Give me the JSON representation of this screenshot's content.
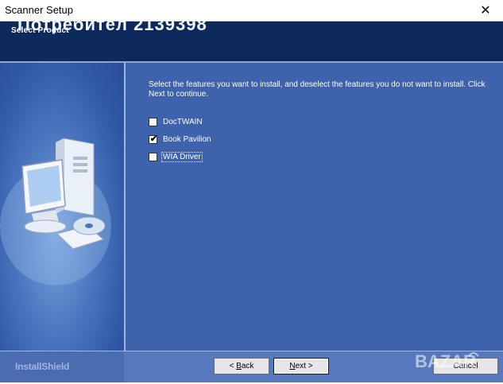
{
  "window": {
    "title": "Scanner Setup",
    "close_label": "✕"
  },
  "header": {
    "subtitle": "Select Product",
    "watermark": "Потребител 2139398"
  },
  "main": {
    "instructions": "Select the features you want to install, and deselect the features you do not want to install.  Click Next to continue.",
    "features": [
      {
        "label": "DocTWAIN",
        "checked": false
      },
      {
        "label": "Book Pavilion",
        "checked": true
      },
      {
        "label": "WIA Driver",
        "checked": false
      }
    ]
  },
  "footer": {
    "brand": "InstallShield",
    "back_label": "Back",
    "back_prefix": "< ",
    "back_accel": "B",
    "next_label": "Next >",
    "next_accel": "N",
    "cancel_label": "Cancel"
  },
  "logo": {
    "text": "BAZAR",
    "icon": "bazar-logo"
  },
  "colors": {
    "header": "#0e2a5c",
    "panel": "#3e63ac",
    "footer": "#5679bd"
  }
}
